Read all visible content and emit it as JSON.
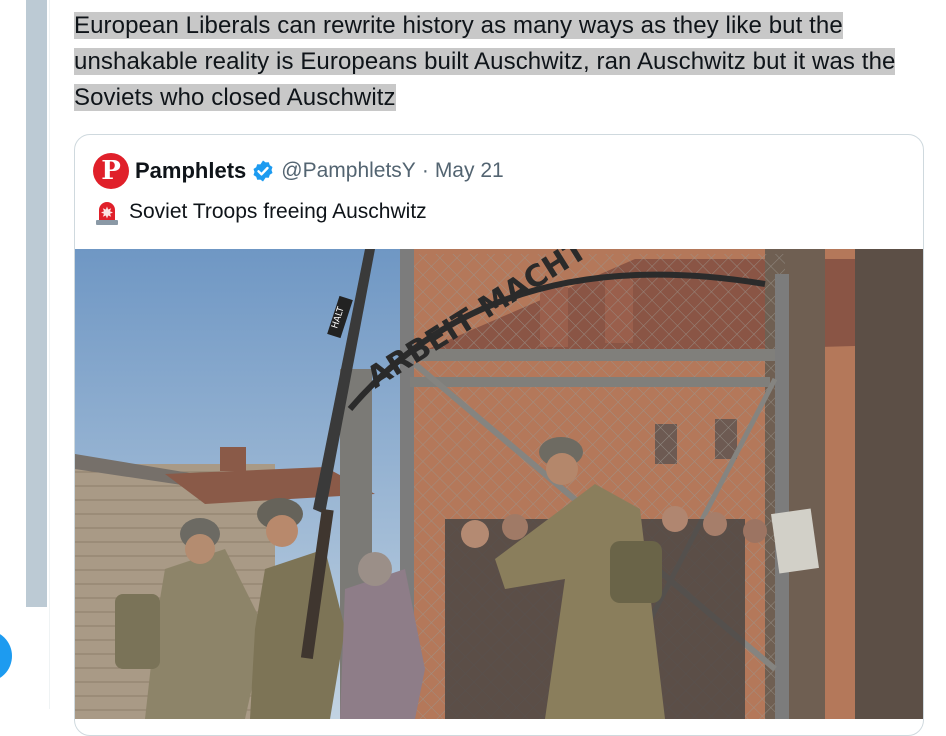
{
  "post": {
    "text": "European Liberals can rewrite history as many ways as they like but the unshakable reality is Europeans built Auschwitz, ran Auschwitz but it was the Soviets who closed Auschwitz"
  },
  "quote": {
    "avatar_letter": "P",
    "author_name": "Pamphlets",
    "handle": "@PamphletsY",
    "separator": "·",
    "date": "May 21",
    "emoji_icon": "police-light-icon",
    "text": "Soviet Troops freeing Auschwitz",
    "gate_sign": "ARBEIT MACHT",
    "sign_halt": "HALT"
  },
  "colors": {
    "accent": "#1d9bf0",
    "avatar_red": "#e0202a",
    "highlight": "#c8c8c8",
    "muted": "#536471"
  }
}
